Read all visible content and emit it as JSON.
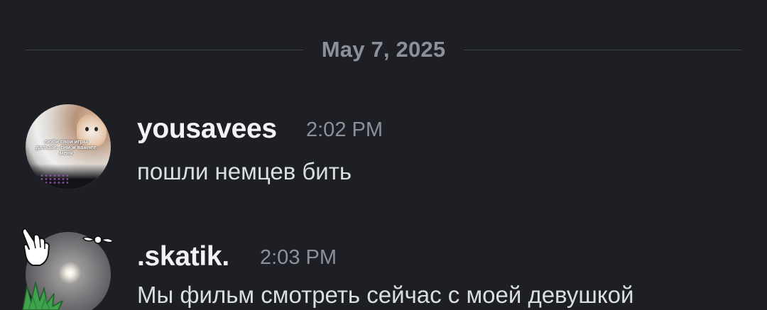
{
  "divider": {
    "date": "May 7, 2025"
  },
  "messages": [
    {
      "author": "yousavees",
      "time": "2:02 PM",
      "text": "пошли немцев бить",
      "avatar_caption": "люби свои игры дальше.. они ж важнее меня"
    },
    {
      "author": ".skatik.",
      "time": "2:03 PM",
      "text": "Мы фильм смотреть сейчас с моей девушкой"
    }
  ],
  "colors": {
    "background": "#1e1f24",
    "username": "#f2f3f5",
    "message_text": "#dbdee1",
    "muted_text": "#8d909a",
    "divider_line": "#3f4148"
  },
  "icons": {
    "hand": "pointing-hand-icon",
    "propeller": "propeller-icon",
    "grass": "grass-icon"
  }
}
